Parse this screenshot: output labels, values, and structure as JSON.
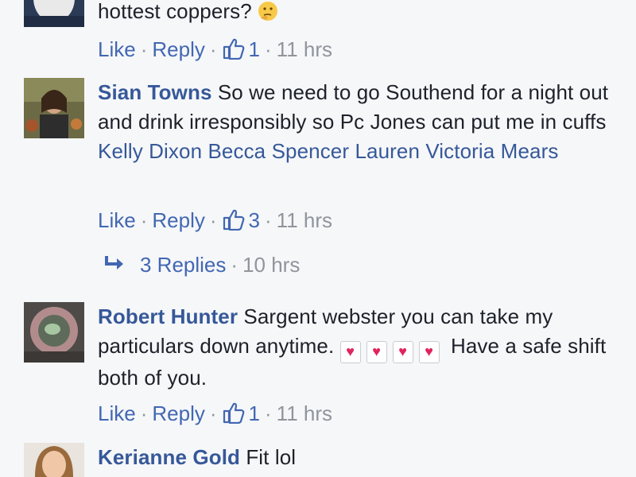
{
  "comments": [
    {
      "text": "hottest coppers?",
      "emoji": "thinking-face",
      "actions": {
        "like": "Like",
        "reply": "Reply",
        "likes": "1",
        "time": "11 hrs"
      }
    },
    {
      "author": "Sian Towns",
      "text": "So we need to go Southend for a night out and drink irresponsibly so Pc Jones can put me in cuffs",
      "mentions": [
        "Kelly Dixon",
        "Becca Spencer",
        "Lauren Victoria Mears"
      ],
      "actions": {
        "like": "Like",
        "reply": "Reply",
        "likes": "3",
        "time": "11 hrs"
      },
      "replies": {
        "label": "3 Replies",
        "time": "10 hrs"
      }
    },
    {
      "author": "Robert Hunter",
      "text_before": "Sargent webster you can take my particulars down anytime.",
      "hearts": 4,
      "text_after": "Have a safe shift both of you.",
      "actions": {
        "like": "Like",
        "reply": "Reply",
        "likes": "1",
        "time": "11 hrs"
      }
    },
    {
      "author": "Kerianne Gold",
      "text": "Fit lol"
    }
  ],
  "separator": "·",
  "colors": {
    "link": "#365899",
    "action": "#4267b2",
    "meta": "#90949c",
    "heart": "#e0245e",
    "background": "#f6f7f9"
  }
}
